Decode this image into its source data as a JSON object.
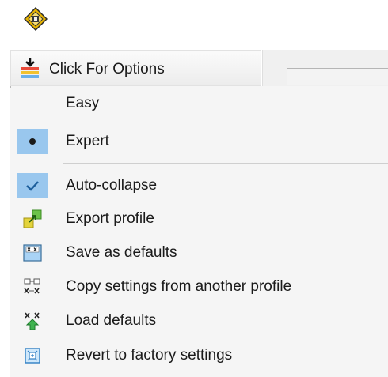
{
  "options_button": {
    "label": "Click For Options",
    "icon": "options-dropdown-icon"
  },
  "menu": {
    "mode_items": [
      {
        "label": "Easy",
        "selected": false
      },
      {
        "label": "Expert",
        "selected": true
      }
    ],
    "action_items": [
      {
        "label": "Auto-collapse",
        "icon": "checkmark-icon",
        "checked": true
      },
      {
        "label": "Export profile",
        "icon": "export-profile-icon"
      },
      {
        "label": "Save as defaults",
        "icon": "save-defaults-icon"
      },
      {
        "label": "Copy settings from another profile",
        "icon": "copy-settings-icon"
      },
      {
        "label": "Load defaults",
        "icon": "load-defaults-icon"
      },
      {
        "label": "Revert to factory settings",
        "icon": "revert-factory-icon"
      }
    ]
  },
  "colors": {
    "checked_highlight": "#99c7ee",
    "menu_background": "#f5f5f5"
  }
}
